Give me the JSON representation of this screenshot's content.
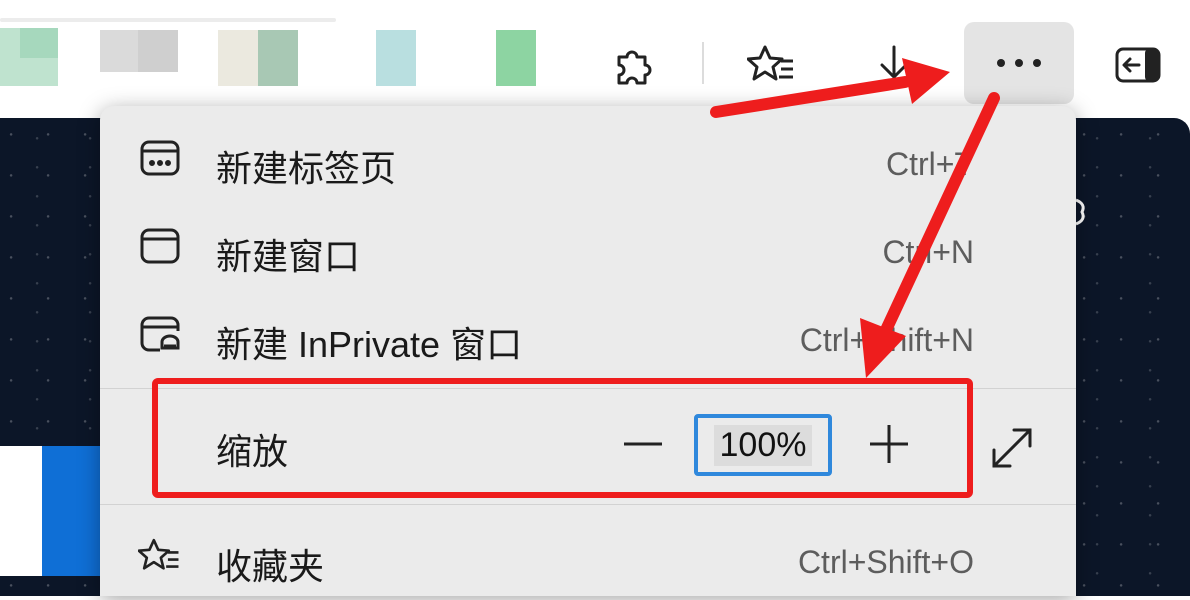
{
  "menu": {
    "items": [
      {
        "label": "新建标签页",
        "shortcut": "Ctrl+T",
        "icon": "new-tab-icon"
      },
      {
        "label": "新建窗口",
        "shortcut": "Ctrl+N",
        "icon": "new-window-icon"
      },
      {
        "label": "新建 InPrivate 窗口",
        "shortcut": "Ctrl+Shift+N",
        "icon": "inprivate-window-icon"
      }
    ],
    "zoom": {
      "label": "缩放",
      "value": "100%",
      "minus": "—",
      "plus": "+"
    },
    "favorites": {
      "label": "收藏夹",
      "shortcut": "Ctrl+Shift+O",
      "icon": "favorites-icon"
    }
  },
  "toolbar": {
    "icons": [
      "extensions-icon",
      "favorites-star-icon",
      "downloads-icon",
      "more-options-icon",
      "sidebar-toggle-icon"
    ]
  },
  "colors": {
    "annotation_red": "#ee1d1d",
    "zoom_focus_blue": "#2f88dc",
    "menu_bg": "#ebebeb"
  }
}
